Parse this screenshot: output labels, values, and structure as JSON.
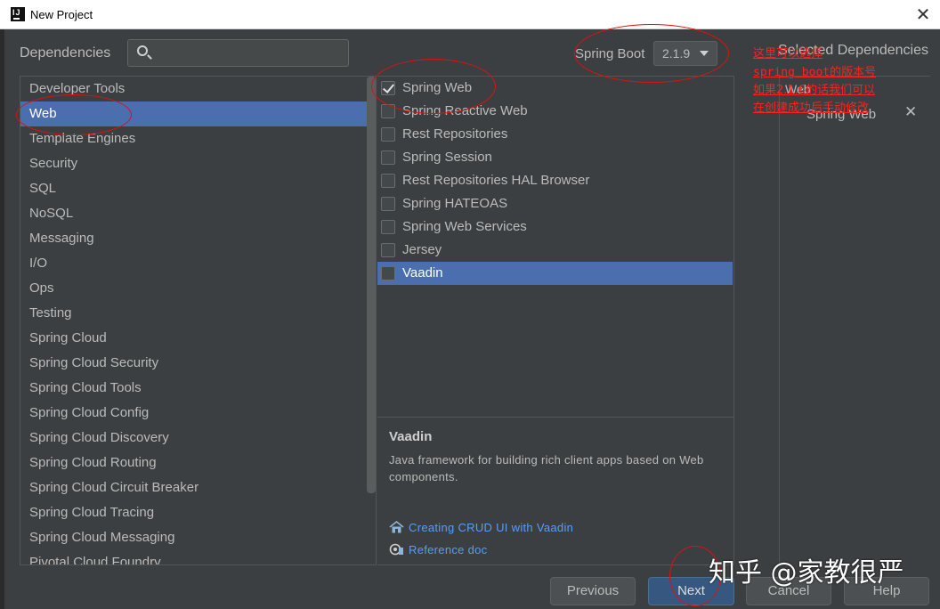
{
  "window": {
    "title": "New Project"
  },
  "header": {
    "dependencies_label": "Dependencies",
    "search_value": "",
    "spring_boot_label": "Spring Boot",
    "spring_boot_version": "2.1.9",
    "selected_title": "Selected Dependencies"
  },
  "categories": [
    "Developer Tools",
    "Web",
    "Template Engines",
    "Security",
    "SQL",
    "NoSQL",
    "Messaging",
    "I/O",
    "Ops",
    "Testing",
    "Spring Cloud",
    "Spring Cloud Security",
    "Spring Cloud Tools",
    "Spring Cloud Config",
    "Spring Cloud Discovery",
    "Spring Cloud Routing",
    "Spring Cloud Circuit Breaker",
    "Spring Cloud Tracing",
    "Spring Cloud Messaging",
    "Pivotal Cloud Foundry"
  ],
  "selected_category": "Web",
  "dependencies": [
    {
      "label": "Spring Web",
      "checked": true
    },
    {
      "label": "Spring Reactive Web",
      "checked": false
    },
    {
      "label": "Rest Repositories",
      "checked": false
    },
    {
      "label": "Spring Session",
      "checked": false
    },
    {
      "label": "Rest Repositories HAL Browser",
      "checked": false
    },
    {
      "label": "Spring HATEOAS",
      "checked": false
    },
    {
      "label": "Spring Web Services",
      "checked": false
    },
    {
      "label": "Jersey",
      "checked": false
    },
    {
      "label": "Vaadin",
      "checked": false
    }
  ],
  "highlighted_dependency": "Vaadin",
  "description": {
    "title": "Vaadin",
    "text": "Java framework for building rich client apps based on Web components.",
    "links": [
      {
        "label": "Creating CRUD UI with Vaadin",
        "icon": "home-icon"
      },
      {
        "label": "Reference doc",
        "icon": "reference-doc-icon"
      }
    ]
  },
  "selected": {
    "group": "Web",
    "items": [
      {
        "label": "Spring Web",
        "remove": "✕"
      }
    ]
  },
  "annotations": [
    "这里可以选择",
    "spring boot的版本号",
    "如果2.1.6的话我们可以",
    "在创建成功后手动修改"
  ],
  "footer": {
    "previous": "Previous",
    "next": "Next",
    "cancel": "Cancel",
    "help": "Help"
  },
  "watermark": "知乎 @家教很严",
  "colors": {
    "background": "#3c3f41",
    "selection": "#4b6eaf",
    "link": "#589df6",
    "annotation": "#ff2020",
    "primary_button": "#365880"
  }
}
